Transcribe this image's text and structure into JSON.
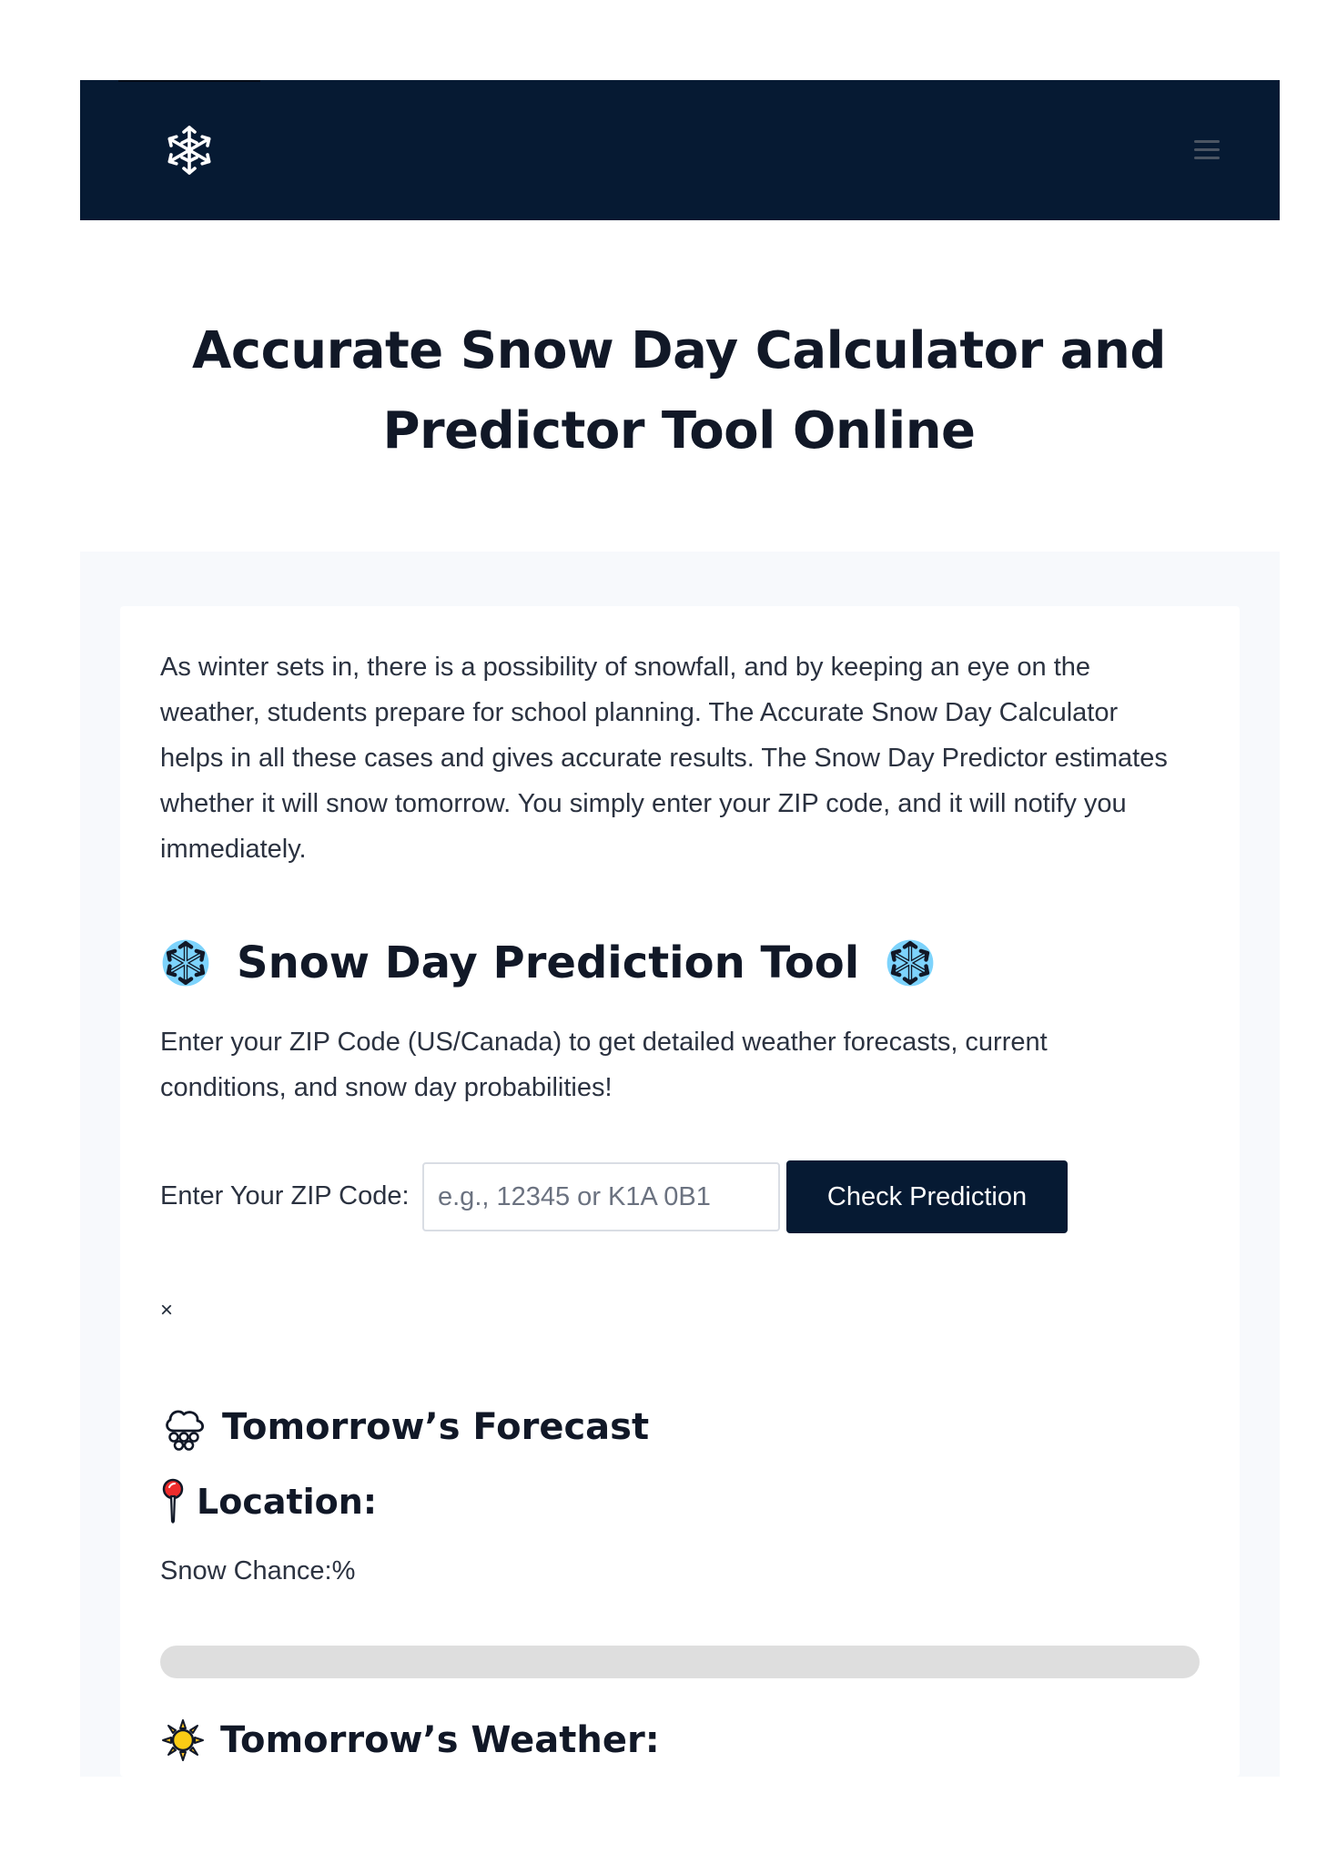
{
  "header": {
    "logo_icon": "snowflake-icon",
    "menu_icon": "hamburger-menu-icon",
    "background": "#061a33"
  },
  "page": {
    "title": "Accurate Snow Day Calculator and Predictor Tool Online"
  },
  "intro": {
    "text": "As winter sets in, there is a possibility of snowfall, and by keeping an eye on the weather, students prepare for school planning. The Accurate Snow Day Calculator helps in all these cases and gives accurate results. The Snow Day Predictor estimates whether it will snow tomorrow. You simply enter your ZIP code, and it will notify you immediately."
  },
  "tool": {
    "heading": "Snow Day Prediction Tool",
    "heading_icon": "snowflake-icon",
    "description": "Enter your ZIP Code (US/Canada) to get detailed weather forecasts, current conditions, and snow day probabilities!",
    "zip_label": "Enter Your ZIP Code:",
    "zip_placeholder": "e.g., 12345 or K1A 0B1",
    "zip_value": "",
    "button_label": "Check Prediction",
    "button_color": "#061a33"
  },
  "result": {
    "close_label": "×",
    "forecast_heading": "Tomorrow’s Forecast",
    "forecast_icon": "snow-cloud-icon",
    "location_heading": "Location:",
    "location_icon": "pushpin-icon",
    "snow_chance_label": "Snow Chance: ",
    "snow_chance_value": "",
    "snow_chance_unit": "%",
    "progress_value": 0,
    "progress_track_color": "#dedede",
    "weather_heading": "Tomorrow’s Weather:",
    "weather_icon": "sun-icon"
  }
}
